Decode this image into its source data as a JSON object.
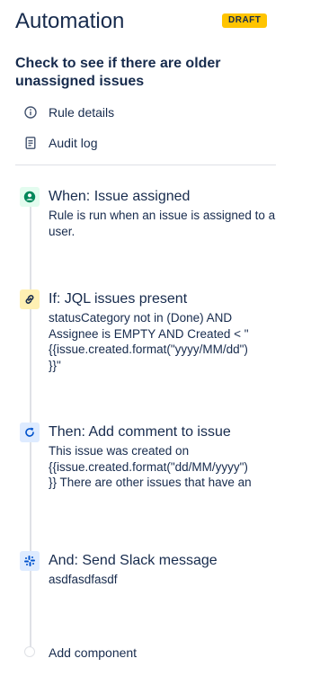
{
  "header": {
    "title": "Automation",
    "badge": "DRAFT",
    "rule_name": "Check to see if there are older unassigned issues"
  },
  "nav": [
    {
      "label": "Rule details",
      "icon": "info-icon"
    },
    {
      "label": "Audit log",
      "icon": "document-icon"
    }
  ],
  "steps": [
    {
      "title": "When: Issue assigned",
      "description": "Rule is run when an issue is assigned to a user.",
      "icon": "trigger-icon"
    },
    {
      "title": "If: JQL issues present",
      "description": "statusCategory not in (Done) AND Assignee is EMPTY AND Created < \"\n{{issue.created.format(\"yyyy/MM/dd\")\n}}\"",
      "icon": "link-icon"
    },
    {
      "title": "Then: Add comment to issue",
      "description": "This issue was created on\n{{issue.created.format(\"dd/MM/yyyy\")\n}} There are other issues that have an",
      "icon": "refresh-icon"
    },
    {
      "title": "And: Send Slack message",
      "description": "asdfasdfasdf",
      "icon": "slack-icon"
    }
  ],
  "add_component": {
    "label": "Add component"
  },
  "colors": {
    "trigger_bg": "#E3FCEF",
    "trigger_fg": "#00875A",
    "condition_bg": "#FFF0B3",
    "condition_fg": "#172B4D",
    "action_bg": "#DEEBFF",
    "action_fg": "#0052CC",
    "draft_bg": "#FFC400"
  }
}
